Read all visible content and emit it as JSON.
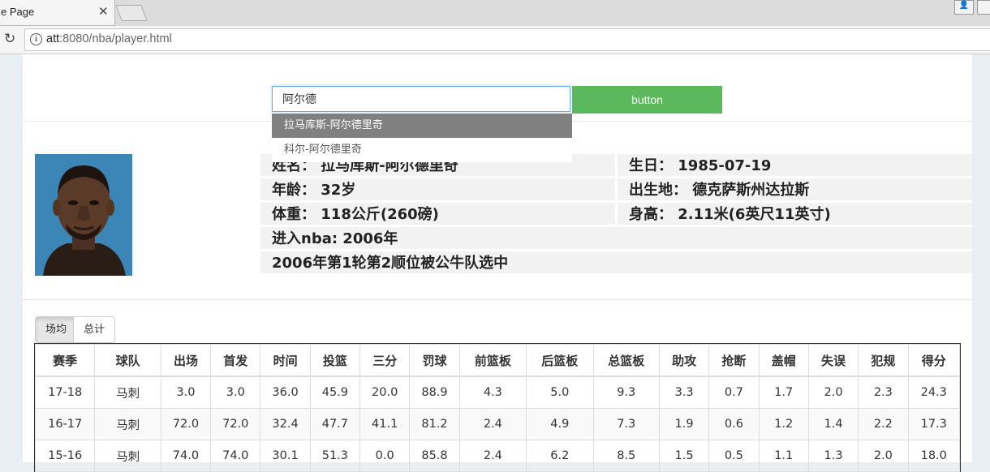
{
  "browser": {
    "tab_title": "e Page",
    "url_host": "att",
    "url_rest": ":8080/nba/player.html"
  },
  "search": {
    "value": "阿尔德",
    "button_label": "button",
    "suggestions": [
      "拉马库斯-阿尔德里奇",
      "科尔-阿尔德里奇"
    ]
  },
  "player": {
    "name": "姓名： 拉马库斯-阿尔德里奇",
    "birthday": "生日： 1985-07-19",
    "age": "年龄： 32岁",
    "birthplace": "出生地： 德克萨斯州达拉斯",
    "weight": "体重： 118公斤(260磅)",
    "height": "身高： 2.11米(6英尺11英寸)",
    "nba_entry": "进入nba: 2006年",
    "draft": "2006年第1轮第2顺位被公牛队选中"
  },
  "stat_tabs": [
    "场均",
    "总计"
  ],
  "table": {
    "headers": [
      "赛季",
      "球队",
      "出场",
      "首发",
      "时间",
      "投篮",
      "三分",
      "罚球",
      "前篮板",
      "后篮板",
      "总篮板",
      "助攻",
      "抢断",
      "盖帽",
      "失误",
      "犯规",
      "得分"
    ],
    "rows": [
      [
        "17-18",
        "马刺",
        "3.0",
        "3.0",
        "36.0",
        "45.9",
        "20.0",
        "88.9",
        "4.3",
        "5.0",
        "9.3",
        "3.3",
        "0.7",
        "1.7",
        "2.0",
        "2.3",
        "24.3"
      ],
      [
        "16-17",
        "马刺",
        "72.0",
        "72.0",
        "32.4",
        "47.7",
        "41.1",
        "81.2",
        "2.4",
        "4.9",
        "7.3",
        "1.9",
        "0.6",
        "1.2",
        "1.4",
        "2.2",
        "17.3"
      ],
      [
        "15-16",
        "马刺",
        "74.0",
        "74.0",
        "30.1",
        "51.3",
        "0.0",
        "85.8",
        "2.4",
        "6.2",
        "8.5",
        "1.5",
        "0.5",
        "1.1",
        "1.3",
        "2.0",
        "18.0"
      ]
    ]
  },
  "colors": {
    "button_green": "#5cb85c",
    "suggest_active": "#808080",
    "input_focus": "#66afe9"
  }
}
